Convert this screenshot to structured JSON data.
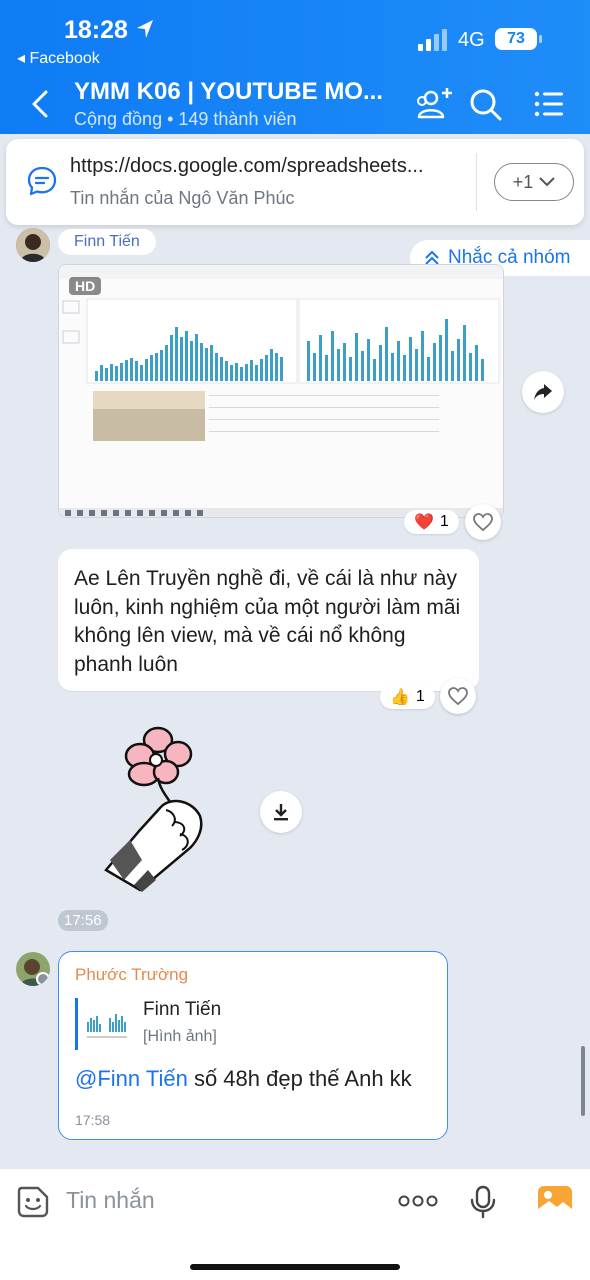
{
  "status_bar": {
    "time": "18:28",
    "back_app": "◂ Facebook",
    "network": "4G",
    "battery": "73"
  },
  "header": {
    "title": "YMM K06 | YOUTUBE MO...",
    "subtitle": "Cộng đồng • 149 thành viên",
    "icons": [
      "back-icon",
      "add-member-icon",
      "search-icon",
      "menu-list-icon"
    ]
  },
  "pinned": {
    "url": "https://docs.google.com/spreadsheets...",
    "sub": "Tin nhắn của Ngô Văn Phúc",
    "more": "+1"
  },
  "message1": {
    "sender": "Finn Tiến",
    "hd_badge": "HD",
    "reaction_count": "1",
    "reaction_emoji": "❤️"
  },
  "mention_all": "Nhắc cả nhóm",
  "message2": {
    "text": "Ae Lên Truyền nghề đi, về cái là như này luôn, kinh nghiệm của một người làm mãi không lên view, mà về cái nổ không phanh luôn",
    "reaction_emoji": "👍",
    "reaction_count": "1"
  },
  "sticker_time": "17:56",
  "reply": {
    "sender": "Phước Trường",
    "quote_name": "Finn Tiến",
    "quote_type": "[Hình ảnh]",
    "mention": "@Finn Tiến",
    "text": " số 48h đẹp thế Anh kk",
    "time": "17:58"
  },
  "input": {
    "placeholder": "Tin nhắn",
    "more": "ooo"
  },
  "colors": {
    "header": "#1582f7",
    "accent": "#1b74e8",
    "sender_orange": "#e58a4b"
  }
}
